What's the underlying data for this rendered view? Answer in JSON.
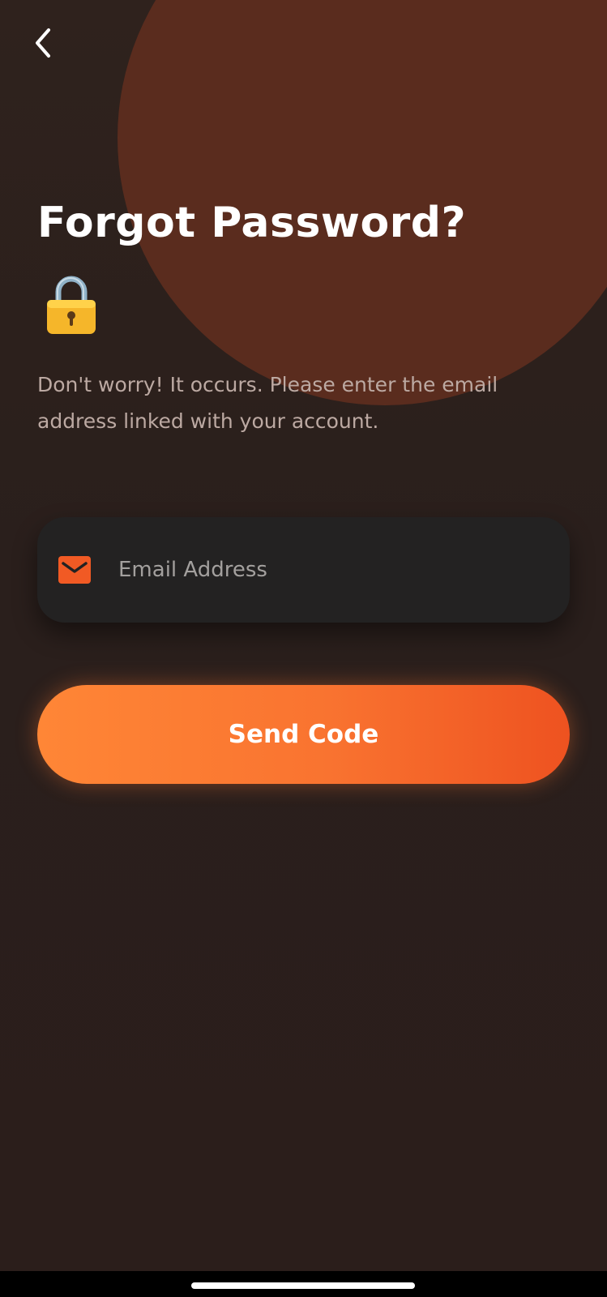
{
  "header": {
    "back_icon": "chevron-left-icon"
  },
  "main": {
    "title": "Forgot Password?",
    "title_icon": "lock-icon",
    "subtitle": "Don't worry! It occurs. Please enter the email address linked with your account.",
    "email_field": {
      "icon": "mail-icon",
      "placeholder": "Email Address",
      "value": ""
    },
    "send_button_label": "Send Code"
  },
  "colors": {
    "background": "#2a1f1c",
    "accent_circle": "#5a2c1e",
    "button_gradient_start": "#ff8636",
    "button_gradient_end": "#ee5220",
    "field_background": "#232222",
    "mail_icon": "#f15a24"
  }
}
